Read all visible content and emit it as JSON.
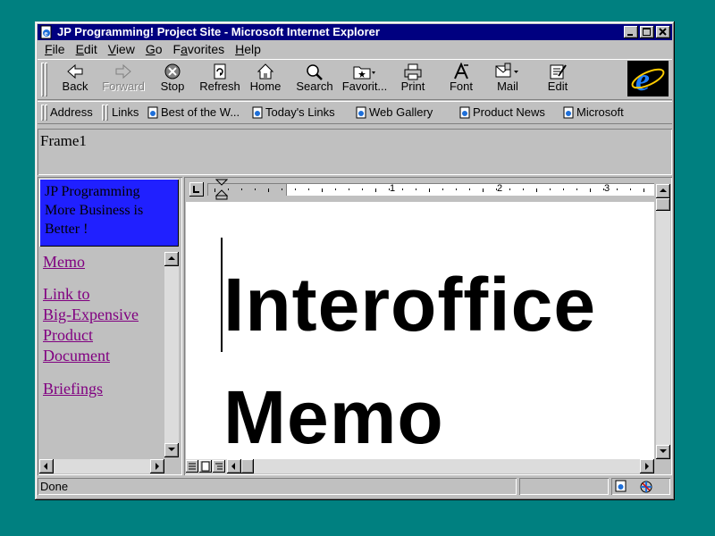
{
  "window": {
    "title": "JP Programming! Project Site - Microsoft Internet Explorer"
  },
  "menu": [
    "File",
    "Edit",
    "View",
    "Go",
    "Favorites",
    "Help"
  ],
  "menu_underline": [
    "F",
    "E",
    "V",
    "G",
    "a",
    "H"
  ],
  "toolbar": {
    "back": "Back",
    "forward": "Forward",
    "stop": "Stop",
    "refresh": "Refresh",
    "home": "Home",
    "search": "Search",
    "favorites": "Favorit...",
    "print": "Print",
    "font": "Font",
    "mail": "Mail",
    "edit": "Edit"
  },
  "addressbar": {
    "address_label": "Address",
    "links_label": "Links"
  },
  "links": [
    "Best of the W...",
    "Today's Links",
    "Web Gallery",
    "Product News",
    "Microsoft"
  ],
  "frame1": {
    "label": "Frame1"
  },
  "sidebar": {
    "banner": [
      "JP Programming",
      "More Business is",
      "Better !"
    ],
    "links": [
      "Memo",
      "Link to",
      "Big-Expensive",
      "Product",
      "Document",
      "Briefings"
    ]
  },
  "ruler": {
    "marks": [
      "1",
      "2",
      "3"
    ]
  },
  "document": {
    "lines": [
      "Interoffice",
      "Memo"
    ]
  },
  "status": {
    "text": "Done"
  },
  "icons": [
    "back-icon",
    "forward-icon",
    "stop-icon",
    "refresh-icon",
    "home-icon",
    "search-icon",
    "favorites-icon",
    "print-icon",
    "font-icon",
    "mail-icon",
    "edit-icon",
    "ie-logo-icon"
  ]
}
